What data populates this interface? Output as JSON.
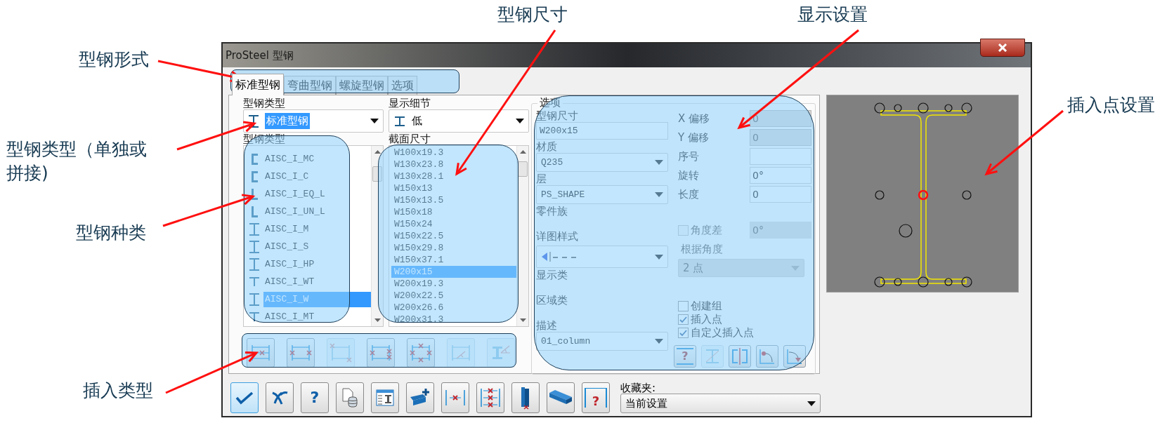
{
  "annotations": [
    {
      "text": "型钢形式"
    },
    {
      "text": "型钢类型（单独或拼接)"
    },
    {
      "text": "型钢种类"
    },
    {
      "text": "插入类型"
    },
    {
      "text": "型钢尺寸"
    },
    {
      "text": "显示设置"
    },
    {
      "text": "插入点设置"
    }
  ],
  "window": {
    "title": "ProSteel 型钢"
  },
  "tabs": [
    {
      "label": "标准型钢",
      "selected": true
    },
    {
      "label": "弯曲型钢",
      "selected": false
    },
    {
      "label": "螺旋型钢",
      "selected": false
    },
    {
      "label": "选项",
      "selected": false
    }
  ],
  "profile_type": {
    "label": "型钢类型",
    "value": "标准型钢",
    "focused": true
  },
  "display_detail": {
    "label": "显示细节",
    "value": "低"
  },
  "profile_list": {
    "label": "型钢类型",
    "items": [
      {
        "text": "AISC_I_MC",
        "kind": "channel",
        "selected": false
      },
      {
        "text": "AISC_I_C",
        "kind": "channel",
        "selected": false
      },
      {
        "text": "AISC_I_EQ_L",
        "kind": "angle",
        "selected": false
      },
      {
        "text": "AISC_I_UN_L",
        "kind": "angle",
        "selected": false
      },
      {
        "text": "AISC_I_M",
        "kind": "ibeam",
        "selected": false
      },
      {
        "text": "AISC_I_S",
        "kind": "ibeam",
        "selected": false
      },
      {
        "text": "AISC_I_HP",
        "kind": "ibeam",
        "selected": false
      },
      {
        "text": "AISC_I_WT",
        "kind": "tee",
        "selected": false
      },
      {
        "text": "AISC_I_W",
        "kind": "ibeam",
        "selected": true
      },
      {
        "text": "AISC_I_MT",
        "kind": "tee",
        "selected": false
      }
    ]
  },
  "size_list": {
    "label": "截面尺寸",
    "items": [
      {
        "text": "W100x19.3",
        "selected": false
      },
      {
        "text": "W130x23.8",
        "selected": false
      },
      {
        "text": "W130x28.1",
        "selected": false
      },
      {
        "text": "W150x13",
        "selected": false
      },
      {
        "text": "W150x13.5",
        "selected": false
      },
      {
        "text": "W150x18",
        "selected": false
      },
      {
        "text": "W150x24",
        "selected": false
      },
      {
        "text": "W150x22.5",
        "selected": false
      },
      {
        "text": "W150x29.8",
        "selected": false
      },
      {
        "text": "W150x37.1",
        "selected": false
      },
      {
        "text": "W200x15",
        "selected": true
      },
      {
        "text": "W200x19.3",
        "selected": false
      },
      {
        "text": "W200x22.5",
        "selected": false
      },
      {
        "text": "W200x26.6",
        "selected": false
      },
      {
        "text": "W200x31.3",
        "selected": false
      }
    ]
  },
  "insert_types": [
    {
      "kind": "center",
      "disabled": false
    },
    {
      "kind": "sides",
      "disabled": false
    },
    {
      "kind": "corners",
      "disabled": true
    },
    {
      "kind": "right",
      "disabled": false
    },
    {
      "kind": "cross",
      "disabled": false
    },
    {
      "kind": "angle",
      "disabled": true
    },
    {
      "kind": "ibeam-angle",
      "disabled": true
    }
  ],
  "options": {
    "title": "选项",
    "left_fields": [
      {
        "label": "型钢尺寸",
        "kind": "text",
        "value": "W200x15"
      },
      {
        "label": "材质",
        "kind": "combo",
        "value": "Q235"
      },
      {
        "label": "层",
        "kind": "combo",
        "value": "PS_SHAPE"
      },
      {
        "label": "零件族",
        "kind": "label"
      },
      {
        "label": "详图样式",
        "kind": "linestyle"
      },
      {
        "label": "显示类",
        "kind": "label"
      },
      {
        "label": "区域类",
        "kind": "label"
      },
      {
        "label": "描述",
        "kind": "combo",
        "value": "01_column"
      }
    ],
    "right_fields": [
      {
        "label": "X 偏移",
        "value": "0",
        "disabled": true
      },
      {
        "label": "Y 偏移",
        "value": "0",
        "disabled": true
      },
      {
        "label": "序号",
        "disabled": false
      },
      {
        "label": "旋转",
        "value": "0°",
        "disabled": false
      },
      {
        "label": "长度",
        "value": "0",
        "disabled": false
      }
    ],
    "angle_diff": {
      "label": "角度差",
      "checked": false,
      "disabled": true,
      "value": "0°"
    },
    "by_angle": {
      "label": "根据角度",
      "value": "2 点",
      "disabled": true
    },
    "checkboxes": [
      {
        "label": "创建组",
        "checked": false
      },
      {
        "label": "插入点",
        "checked": true
      },
      {
        "label": "自定义插入点",
        "checked": true
      }
    ],
    "buttons": [
      {
        "kind": "help",
        "glyph": "?",
        "disabled": false
      },
      {
        "kind": "ibeam-cross",
        "disabled": true
      },
      {
        "kind": "mirror",
        "disabled": false
      },
      {
        "kind": "rotate-left",
        "disabled": false
      },
      {
        "kind": "rotate-down",
        "disabled": false
      }
    ]
  },
  "preview": {
    "points": [
      {
        "selected": false
      },
      {
        "selected": false
      },
      {
        "selected": false
      },
      {
        "selected": false
      },
      {
        "selected": false
      },
      {
        "selected": false
      },
      {
        "selected": true
      },
      {
        "selected": false
      },
      {
        "selected": false
      },
      {
        "selected": false
      },
      {
        "selected": false
      },
      {
        "selected": false
      },
      {
        "selected": false
      },
      {
        "selected": false
      }
    ]
  },
  "toolbar": [
    {
      "kind": "ok",
      "selected": true
    },
    {
      "kind": "cancel",
      "selected": false
    },
    {
      "kind": "help",
      "glyph": "?",
      "selected": false
    },
    {
      "kind": "document-database",
      "selected": false
    },
    {
      "kind": "table",
      "selected": false
    },
    {
      "kind": "beam-add",
      "selected": false
    },
    {
      "kind": "single-insert",
      "selected": false
    },
    {
      "kind": "multi-insert",
      "selected": false
    },
    {
      "kind": "column",
      "selected": false
    },
    {
      "kind": "beam",
      "selected": false
    },
    {
      "kind": "frame-help",
      "glyph": "?",
      "selected": false
    }
  ],
  "favorites": {
    "label": "收藏夹:",
    "value": "当前设置"
  }
}
